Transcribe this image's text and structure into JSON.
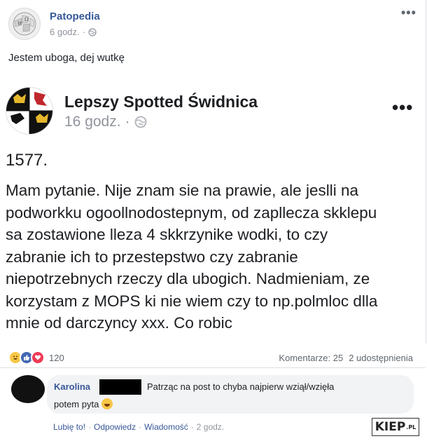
{
  "outer_post": {
    "page_name": "Patopedia",
    "time": "6 godz.",
    "dot": "·",
    "text": "Jestem uboga, dej wutkę",
    "more_icon": "more-horizontal-icon",
    "privacy_icon": "globe-icon"
  },
  "shared_post": {
    "page_name": "Lepszy Spotted Świdnica",
    "time": "16 godz.",
    "dot": "·",
    "number": "1577.",
    "body_lines": [
      "Mam pytanie. Nije znam sie na prawie, ale jeslli na",
      "podworkku ogoollnodostepnym, od zapllecza skklepu",
      "sa zostawione lleza 4 skkrzynike wodki, to czy",
      "zabranie ich to przestepstwo czy zabranie",
      "niepotrzebnych rzeczy dla ubogich. Nadmieniam, ze",
      "korzystam z MOPS ki nie wiem czy to np.polmloc dlla",
      "mnie od darczyncy xxx. Co robic"
    ]
  },
  "stats": {
    "reaction_count": "120",
    "comments": "Komentarze: 25",
    "shares": "2 udostępnienia",
    "reactions": [
      "haha",
      "like",
      "love"
    ]
  },
  "comment": {
    "author": "Karolina",
    "text_line1": "Patrząc na post to chyba najpierw wziął/wzięła",
    "text_line2": "potem pyta",
    "like": "Lubię to!",
    "reply": "Odpowiedz",
    "message": "Wiadomość",
    "time": "2 godz.",
    "sep": "·"
  },
  "watermark": {
    "main": "KIEP",
    "suffix": ".PL"
  }
}
